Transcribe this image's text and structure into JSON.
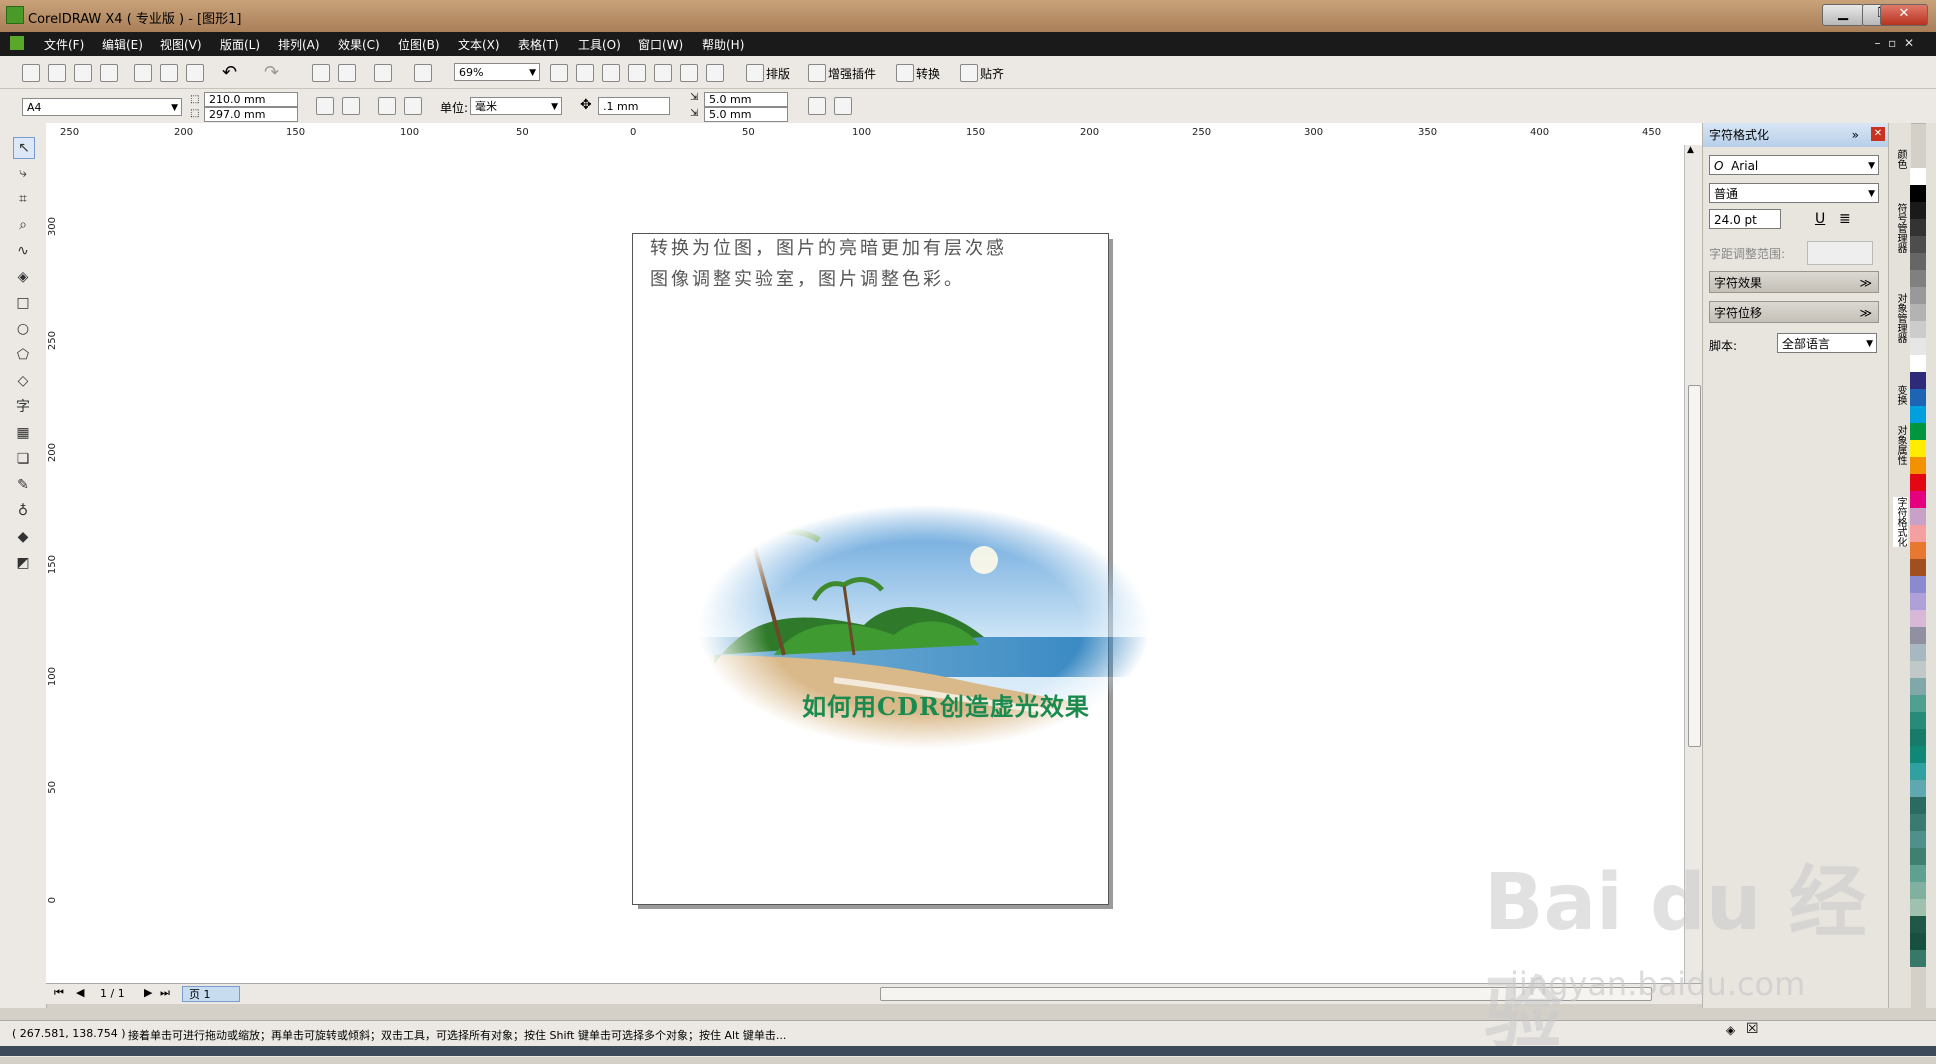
{
  "window": {
    "title": "CorelDRAW X4 ( 专业版 ) - [图形1]"
  },
  "menu": [
    "文件(F)",
    "编辑(E)",
    "视图(V)",
    "版面(L)",
    "排列(A)",
    "效果(C)",
    "位图(B)",
    "文本(X)",
    "表格(T)",
    "工具(O)",
    "窗口(W)",
    "帮助(H)"
  ],
  "toolbar": {
    "zoom": "69%",
    "addon_labels": [
      "排版",
      "增强插件",
      "转换",
      "贴齐"
    ]
  },
  "propbar": {
    "paper": "A4",
    "width": "210.0 mm",
    "height": "297.0 mm",
    "unit_label": "单位:",
    "unit": "毫米",
    "nudge": ".1 mm",
    "dup_x": "5.0 mm",
    "dup_y": "5.0 mm"
  },
  "ruler_h": [
    "250",
    "200",
    "150",
    "100",
    "50",
    "0",
    "50",
    "100",
    "150",
    "200",
    "250",
    "300",
    "350",
    "400",
    "450"
  ],
  "ruler_v": [
    "300",
    "250",
    "200",
    "150",
    "100",
    "50",
    "0"
  ],
  "page": {
    "text_lines": [
      "转换为位图，图片的亮暗更加有层次感",
      "图像调整实验室，图片调整色彩。"
    ],
    "caption": "如何用CDR创造虚光效果"
  },
  "page_nav": {
    "counter": "1 / 1",
    "tab": "页 1"
  },
  "status": {
    "coords": "( 267.581, 138.754 )",
    "message": "接着单击可进行拖动或缩放；再单击可旋转或倾斜；双击工具，可选择所有对象；按住 Shift 键单击可选择多个对象；按住 Alt 键单击..."
  },
  "docker": {
    "title": "字符格式化",
    "font": "Arial",
    "style": "普通",
    "size": "24.0 pt",
    "spacing_label": "字距调整范围:",
    "section1": "字符效果",
    "section2": "字符位移",
    "script_label": "脚本:",
    "script": "全部语言"
  },
  "vtabs": [
    "颜色",
    "符号管理器",
    "对象管理器",
    "变换",
    "对象属性",
    "字符格式化"
  ],
  "palette": [
    "#ffffff",
    "#000000",
    "#1a1a1a",
    "#333333",
    "#4d4d4d",
    "#666666",
    "#808080",
    "#999999",
    "#b3b3b3",
    "#cccccc",
    "#e6e6e6",
    "#ffffff",
    "#2e2a78",
    "#1e64b4",
    "#00a0e0",
    "#009640",
    "#ffed00",
    "#f39200",
    "#e30613",
    "#e5007e",
    "#c8a0c8",
    "#f5a0a0",
    "#e87830",
    "#a05020",
    "#8a8ad0",
    "#b0a0d8",
    "#d8b8d8",
    "#9090a0",
    "#a8b8c0",
    "#c0c8c8",
    "#80a8a8",
    "#50a090",
    "#2a8a78",
    "#1a7a6a",
    "#108878",
    "#30a0a0",
    "#60a8b0",
    "#2a6a60",
    "#3a7a70",
    "#50908a",
    "#408070",
    "#60a090",
    "#80b0a0",
    "#a0c0b0",
    "#205848",
    "#185040",
    "#387868"
  ],
  "watermark": {
    "main": "Bai du 经验",
    "sub": "jingyan.baidu.com"
  }
}
